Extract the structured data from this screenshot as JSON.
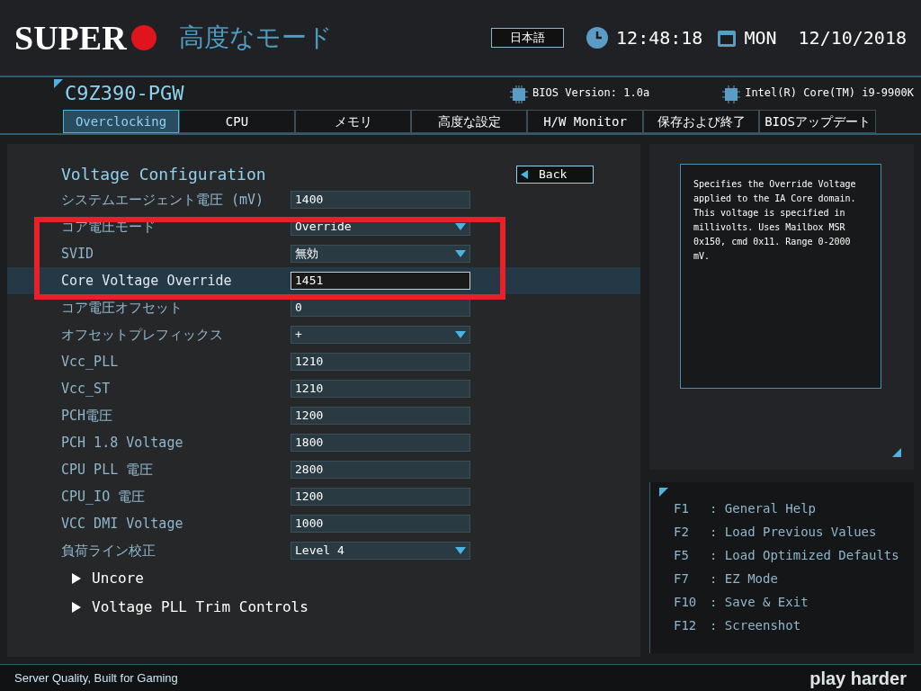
{
  "header": {
    "brand": "SUPER",
    "mode": "高度なモード",
    "language": "日本語",
    "time": "12:48:18",
    "date": "MON  12/10/2018"
  },
  "board": {
    "model": "C9Z390-PGW",
    "bios_version": "BIOS Version: 1.0a",
    "cpu": "Intel(R) Core(TM) i9-9900K"
  },
  "tabs": [
    {
      "label": "Overclocking",
      "selected": true
    },
    {
      "label": "CPU",
      "selected": false
    },
    {
      "label": "メモリ",
      "selected": false
    },
    {
      "label": "高度な設定",
      "selected": false
    },
    {
      "label": "H/W Monitor",
      "selected": false
    },
    {
      "label": "保存および終了",
      "selected": false
    },
    {
      "label": "BIOSアップデート",
      "selected": false
    }
  ],
  "section": {
    "title": "Voltage Configuration",
    "back": "Back"
  },
  "settings": [
    {
      "label": "システムエージェント電圧 (mV)",
      "kind": "input",
      "value": "1400",
      "selected": false
    },
    {
      "label": "コア電圧モード",
      "kind": "select",
      "value": "Override",
      "selected": false
    },
    {
      "label": "SVID",
      "kind": "select",
      "value": "無効",
      "selected": false
    },
    {
      "label": "Core Voltage Override",
      "kind": "input",
      "value": "1451",
      "selected": true
    },
    {
      "label": "コア電圧オフセット",
      "kind": "input",
      "value": "0",
      "selected": false
    },
    {
      "label": "オフセットプレフィックス",
      "kind": "select",
      "value": "+",
      "selected": false
    },
    {
      "label": "Vcc_PLL",
      "kind": "input",
      "value": "1210",
      "selected": false
    },
    {
      "label": "Vcc_ST",
      "kind": "input",
      "value": "1210",
      "selected": false
    },
    {
      "label": "PCH電圧",
      "kind": "input",
      "value": "1200",
      "selected": false
    },
    {
      "label": "PCH 1.8 Voltage",
      "kind": "input",
      "value": "1800",
      "selected": false
    },
    {
      "label": "CPU PLL 電圧",
      "kind": "input",
      "value": "2800",
      "selected": false
    },
    {
      "label": "CPU_IO 電圧",
      "kind": "input",
      "value": "1200",
      "selected": false
    },
    {
      "label": "VCC DMI Voltage",
      "kind": "input",
      "value": "1000",
      "selected": false
    },
    {
      "label": "負荷ライン校正",
      "kind": "select",
      "value": "Level 4",
      "selected": false
    }
  ],
  "submenus": [
    "Uncore",
    "Voltage PLL Trim Controls"
  ],
  "help_text": "Specifies the Override Voltage applied to the IA Core domain. This voltage is specified in millivolts. Uses Mailbox MSR 0x150, cmd 0x11. Range 0-2000 mV.",
  "hotkeys": [
    {
      "key": "F1",
      "action": ": General Help"
    },
    {
      "key": "F2",
      "action": ": Load Previous Values"
    },
    {
      "key": "F5",
      "action": ": Load Optimized Defaults"
    },
    {
      "key": "F7",
      "action": ": EZ Mode"
    },
    {
      "key": "F10",
      "action": ": Save & Exit"
    },
    {
      "key": "F12",
      "action": ": Screenshot"
    }
  ],
  "footer": {
    "slogan": "Server Quality, Built for Gaming",
    "tagline": "play harder"
  }
}
